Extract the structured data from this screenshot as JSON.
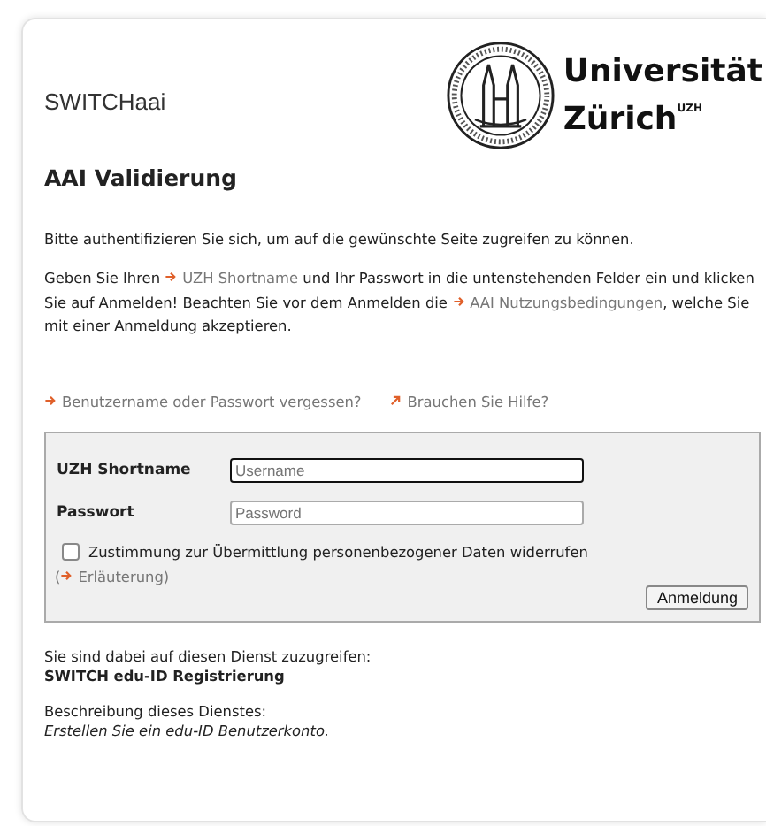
{
  "header": {
    "brand": "SWITCHaai",
    "logo_line1": "Universität",
    "logo_line2": "Zürich$^{UZH}$"
  },
  "title": "AAI Validierung",
  "intro": "Bitte authentifizieren Sie sich, um auf die gewünschte Seite zugreifen zu können.",
  "instructions": [
    {
      "kind": "text",
      "text": "Geben Sie Ihren "
    },
    {
      "kind": "link",
      "text": "UZH Shortname"
    },
    {
      "kind": "text",
      "text": " und Ihr Passwort in die untenstehenden Felder ein und klicken Sie auf Anmelden! Beachten Sie vor dem Anmelden die "
    },
    {
      "kind": "link",
      "text": "AAI Nutzungsbedingungen"
    },
    {
      "kind": "text",
      "text": ", welche Sie mit einer Anmeldung akzeptieren."
    }
  ],
  "help_links": [
    {
      "kind": "internal",
      "text": "Benutzername oder Passwort vergessen?"
    },
    {
      "kind": "external",
      "text": "Brauchen Sie Hilfe?"
    }
  ],
  "form": {
    "fields": [
      {
        "label": "UZH Shortname",
        "placeholder": "Username",
        "focused": true
      },
      {
        "label": "Passwort",
        "placeholder": "Password",
        "focused": false
      }
    ],
    "consent": {
      "label": "Zustimmung zur Übermittlung personenbezogener Daten widerrufen",
      "checked": false
    },
    "explanation_open": "(",
    "explanation_link": "Erläuterung",
    "explanation_close": ")",
    "submit": "Anmeldung"
  },
  "service": {
    "intro": "Sie sind dabei auf diesen Dienst zuzugreifen:",
    "name": "SWITCH edu-ID Registrierung",
    "description_label": "Beschreibung dieses Dienstes:",
    "description": "Erstellen Sie ein edu-ID Benutzerkonto."
  }
}
